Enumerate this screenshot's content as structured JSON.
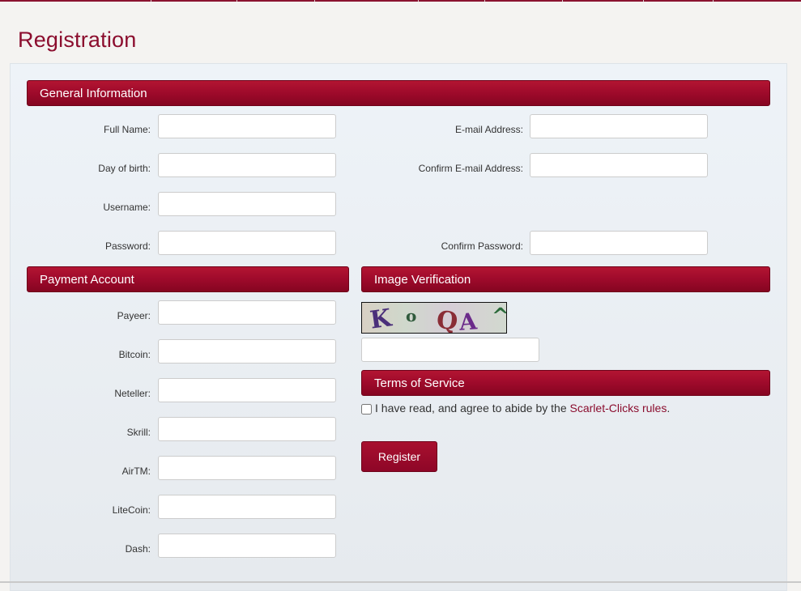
{
  "page": {
    "title": "Registration"
  },
  "general": {
    "heading": "General Information",
    "full_name_label": "Full Name:",
    "email_label": "E-mail Address:",
    "dob_label": "Day of birth:",
    "confirm_email_label": "Confirm E-mail Address:",
    "username_label": "Username:",
    "password_label": "Password:",
    "confirm_password_label": "Confirm Password:"
  },
  "payment": {
    "heading": "Payment Account",
    "fields": [
      "Payeer:",
      "Bitcoin:",
      "Neteller:",
      "Skrill:",
      "AirTM:",
      "LiteCoin:",
      "Dash:"
    ]
  },
  "verification": {
    "heading": "Image Verification",
    "captcha_chars": [
      "K",
      "o",
      "Q",
      "A",
      "^"
    ]
  },
  "terms": {
    "heading": "Terms of Service",
    "agree_text": "I have read, and agree to abide by the",
    "rules_link": "Scarlet-Clicks rules",
    "after_link": "."
  },
  "actions": {
    "register_label": "Register"
  },
  "colors": {
    "accent": "#8b0d2e",
    "header_bar": "#9e0a2b"
  }
}
